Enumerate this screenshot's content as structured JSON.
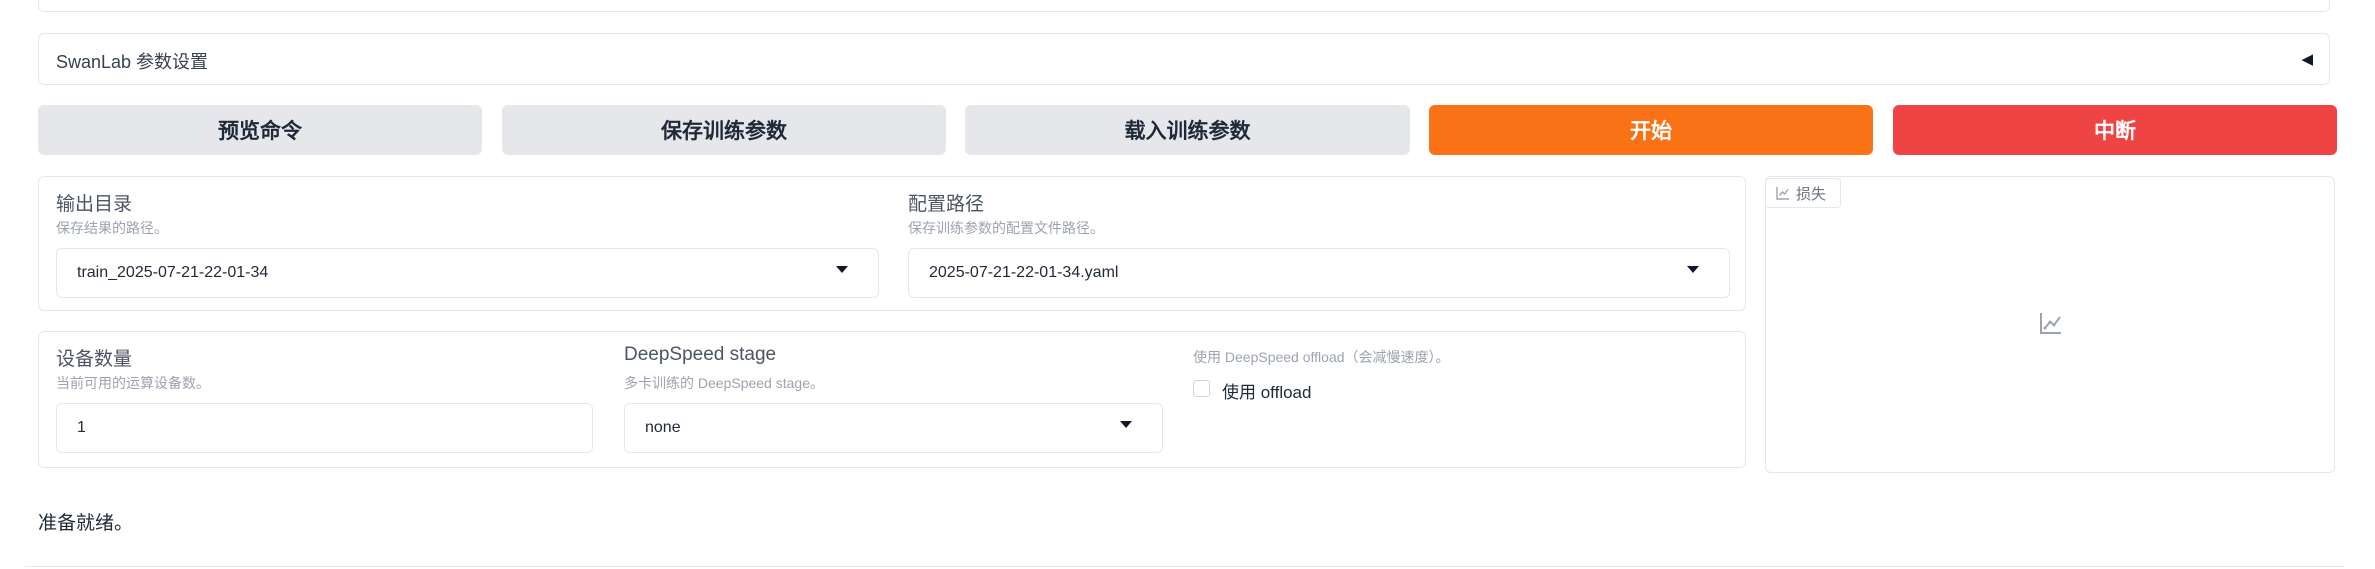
{
  "swanlab": {
    "label": "SwanLab 参数设置",
    "caret": "◀"
  },
  "buttons": {
    "preview": "预览命令",
    "save": "保存训练参数",
    "load": "载入训练参数",
    "start": "开始",
    "abort": "中断"
  },
  "output_dir": {
    "label": "输出目录",
    "info": "保存结果的路径。",
    "value": "train_2025-07-21-22-01-34"
  },
  "config_path": {
    "label": "配置路径",
    "info": "保存训练参数的配置文件路径。",
    "value": "2025-07-21-22-01-34.yaml"
  },
  "device_count": {
    "label": "设备数量",
    "info": "当前可用的运算设备数。",
    "value": "1"
  },
  "ds_stage": {
    "label": "DeepSpeed stage",
    "info": "多卡训练的 DeepSpeed stage。",
    "value": "none"
  },
  "ds_offload": {
    "info": "使用 DeepSpeed offload（会减慢速度）。",
    "label": "使用 offload",
    "checked": false
  },
  "loss_plot": {
    "tab_label": "损失"
  },
  "status": "准备就绪。",
  "colors": {
    "start": "#f97316",
    "abort": "#ef4444",
    "secondary": "#e5e7eb"
  }
}
